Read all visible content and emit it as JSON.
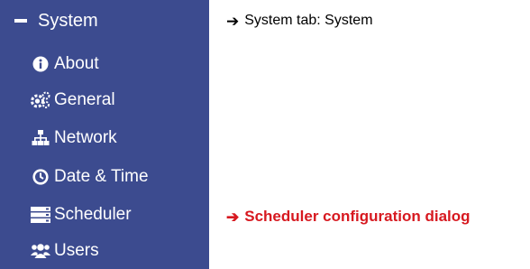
{
  "sidebar": {
    "header": {
      "label": "System",
      "icon": "minus-icon"
    },
    "items": [
      {
        "label": "About",
        "icon": "info-circle-icon"
      },
      {
        "label": "General",
        "icon": "gears-icon"
      },
      {
        "label": "Network",
        "icon": "sitemap-icon"
      },
      {
        "label": "Date & Time",
        "icon": "clock-icon"
      },
      {
        "label": "Scheduler",
        "icon": "server-list-icon"
      },
      {
        "label": "Users",
        "icon": "users-icon"
      }
    ]
  },
  "annotations": [
    {
      "text": "System tab: System",
      "color": "#000000"
    },
    {
      "text": "Scheduler configuration dialog",
      "color": "#d71920"
    }
  ],
  "colors": {
    "sidebar_bg": "#3c4b8f",
    "sidebar_text": "#ffffff"
  }
}
